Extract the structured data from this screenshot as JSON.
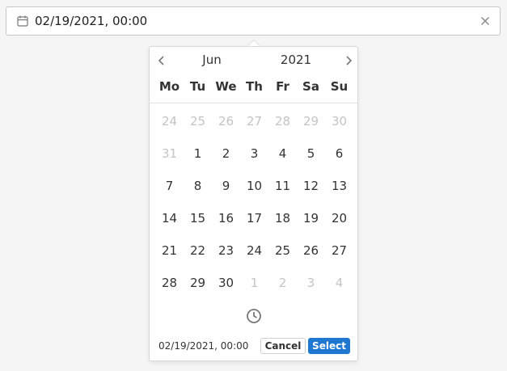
{
  "input": {
    "value": "02/19/2021, 00:00",
    "icon": "calendar-icon",
    "clear_icon": "close-icon"
  },
  "calendar": {
    "month": "Jun",
    "year": "2021",
    "prev_icon": "chevron-left-icon",
    "next_icon": "chevron-right-icon",
    "weekdays": [
      "Mo",
      "Tu",
      "We",
      "Th",
      "Fr",
      "Sa",
      "Su"
    ],
    "weeks": [
      [
        {
          "d": "24",
          "muted": true
        },
        {
          "d": "25",
          "muted": true
        },
        {
          "d": "26",
          "muted": true
        },
        {
          "d": "27",
          "muted": true
        },
        {
          "d": "28",
          "muted": true
        },
        {
          "d": "29",
          "muted": true
        },
        {
          "d": "30",
          "muted": true
        }
      ],
      [
        {
          "d": "31",
          "muted": true
        },
        {
          "d": "1",
          "muted": false
        },
        {
          "d": "2",
          "muted": false
        },
        {
          "d": "3",
          "muted": false
        },
        {
          "d": "4",
          "muted": false
        },
        {
          "d": "5",
          "muted": false
        },
        {
          "d": "6",
          "muted": false
        }
      ],
      [
        {
          "d": "7",
          "muted": false
        },
        {
          "d": "8",
          "muted": false
        },
        {
          "d": "9",
          "muted": false
        },
        {
          "d": "10",
          "muted": false
        },
        {
          "d": "11",
          "muted": false
        },
        {
          "d": "12",
          "muted": false
        },
        {
          "d": "13",
          "muted": false
        }
      ],
      [
        {
          "d": "14",
          "muted": false
        },
        {
          "d": "15",
          "muted": false
        },
        {
          "d": "16",
          "muted": false
        },
        {
          "d": "17",
          "muted": false
        },
        {
          "d": "18",
          "muted": false
        },
        {
          "d": "19",
          "muted": false
        },
        {
          "d": "20",
          "muted": false
        }
      ],
      [
        {
          "d": "21",
          "muted": false
        },
        {
          "d": "22",
          "muted": false
        },
        {
          "d": "23",
          "muted": false
        },
        {
          "d": "24",
          "muted": false
        },
        {
          "d": "25",
          "muted": false
        },
        {
          "d": "26",
          "muted": false
        },
        {
          "d": "27",
          "muted": false
        }
      ],
      [
        {
          "d": "28",
          "muted": false
        },
        {
          "d": "29",
          "muted": false
        },
        {
          "d": "30",
          "muted": false
        },
        {
          "d": "1",
          "muted": true
        },
        {
          "d": "2",
          "muted": true
        },
        {
          "d": "3",
          "muted": true
        },
        {
          "d": "4",
          "muted": true
        }
      ]
    ],
    "time_toggle_icon": "clock-icon"
  },
  "footer": {
    "value": "02/19/2021, 00:00",
    "cancel_label": "Cancel",
    "select_label": "Select"
  },
  "colors": {
    "accent": "#1e78d2",
    "muted_day": "#c4c4c4",
    "text": "#333333"
  }
}
